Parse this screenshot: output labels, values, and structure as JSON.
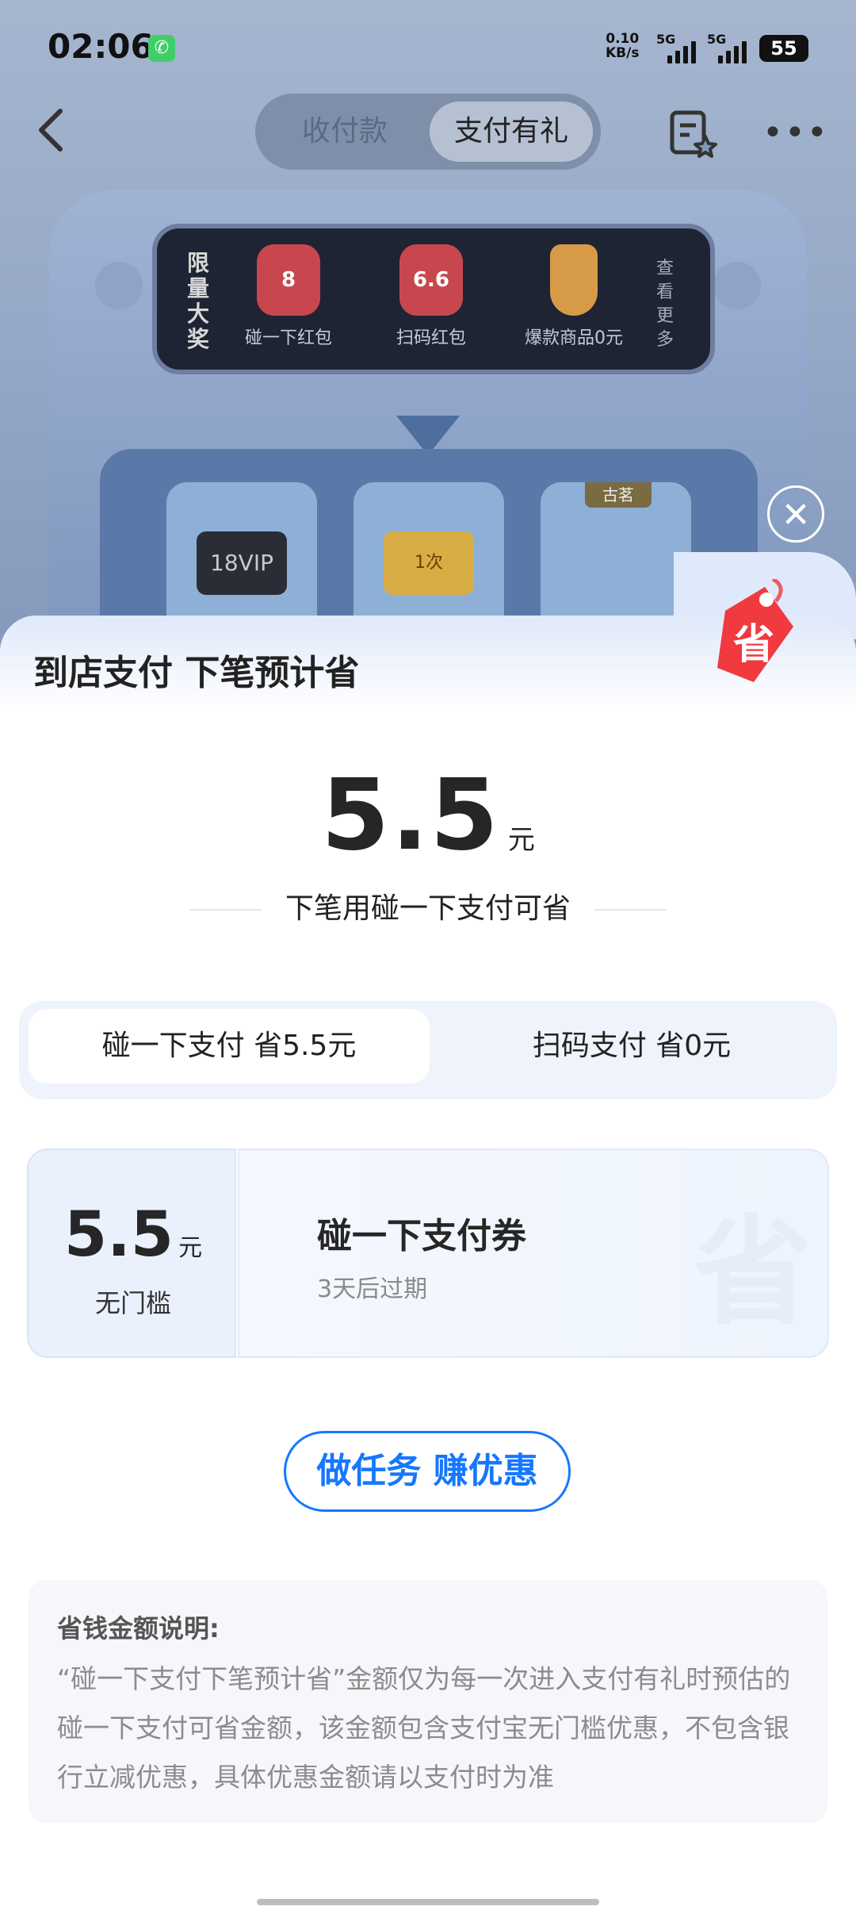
{
  "status_bar": {
    "time": "02:06",
    "net_speed_value": "0.10",
    "net_speed_unit": "KB/s",
    "sim1": "5G",
    "sim2": "5G",
    "battery": "55"
  },
  "navbar": {
    "tabs": [
      "收付款",
      "支付有礼"
    ],
    "active_tab": "支付有礼"
  },
  "background_panel": {
    "vertical_title": "限量大奖",
    "prizes": [
      {
        "badge": "8",
        "label": "碰一下红包"
      },
      {
        "badge": "6.6",
        "label": "扫码红包"
      },
      {
        "badge": "",
        "label": "爆款商品0元"
      }
    ],
    "see_more": "查看更多",
    "slots": [
      {
        "tag": "",
        "card": "18VIP"
      },
      {
        "tag": "",
        "card": "1次"
      },
      {
        "tag": "古茗",
        "card": ""
      }
    ]
  },
  "sheet": {
    "title": "到店支付 下笔预计省",
    "tag_icon_char": "省",
    "amount": "5.5",
    "amount_unit": "元",
    "subtitle": "下笔用碰一下支付可省",
    "tabs": [
      {
        "label": "碰一下支付 省5.5元",
        "active": true
      },
      {
        "label": "扫码支付 省0元",
        "active": false
      }
    ],
    "coupon": {
      "amount": "5.5",
      "unit": "元",
      "condition": "无门槛",
      "title": "碰一下支付券",
      "expire": "3天后过期"
    },
    "task_button": "做任务 赚优惠",
    "notes": {
      "title": "省钱金额说明:",
      "body": "“碰一下支付下笔预计省”金额仅为每一次进入支付有礼时预估的碰一下支付可省金额，该金额包含支付宝无门槛优惠，不包含银行立减优惠，具体优惠金额请以支付时为准"
    }
  },
  "colors": {
    "accent": "#1677ff",
    "tag_red": "#f03a3f",
    "call_green": "#3fcf66"
  }
}
